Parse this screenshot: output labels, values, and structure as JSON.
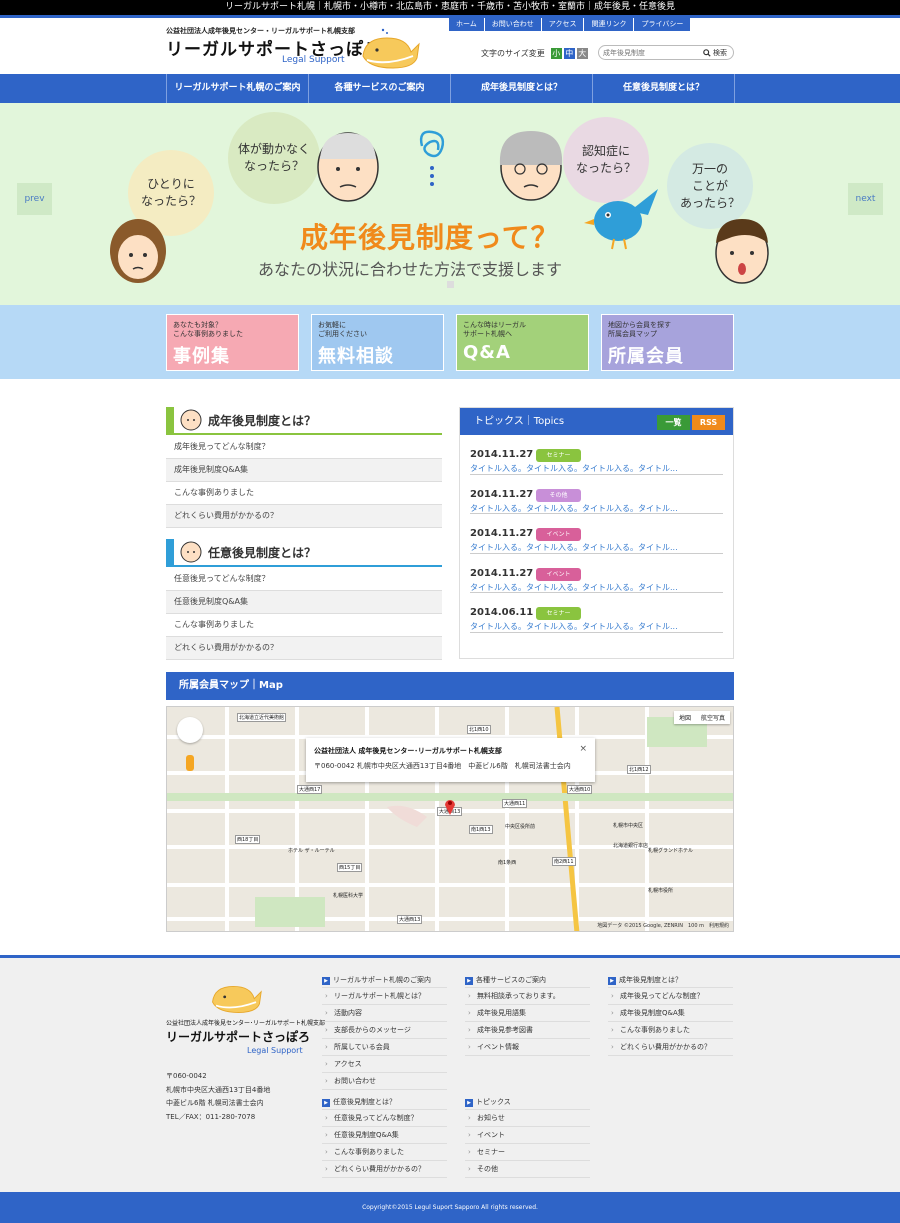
{
  "topbar": {
    "text": "リーガルサポート札幌｜札幌市・小樽市・北広島市・恵庭市・千歳市・苫小牧市・室蘭市｜成年後見・任意後見"
  },
  "header": {
    "org": "公益社団法人成年後見センター・リーガルサポート札幌支部",
    "brand": "リーガルサポートさっぽろ",
    "brand_sub": "Legal Support",
    "util_nav": [
      "ホーム",
      "お問い合わせ",
      "アクセス",
      "関連リンク",
      "プライバシー"
    ],
    "fontsize_label": "文字のサイズ変更",
    "fontsize_options": [
      "小",
      "中",
      "大"
    ],
    "search_placeholder": "成年後見制度",
    "search_button": "検索"
  },
  "gnav": [
    "リーガルサポート札幌のご案内",
    "各種サービスのご案内",
    "成年後見制度とは？",
    "任意後見制度とは？"
  ],
  "hero": {
    "bubbles": [
      "ひとりに\nなったら？",
      "体が動かなく\nなったら？",
      "認知症に\nなったら？",
      "万一の\nことが\nあったら？"
    ],
    "title": "成年後見制度って？",
    "subtitle": "あなたの状況に合わせた方法で支援します",
    "prev": "prev",
    "next": "next"
  },
  "banners": [
    {
      "top": "あなたも対象？\nこんな事例ありました",
      "big": "事例集",
      "color": "#f6a9b3"
    },
    {
      "top": "お気軽に\nご利用ください",
      "big": "無料相談",
      "color": "#9fc8f0"
    },
    {
      "top": "こんな時はリーガル\nサポート札幌へ",
      "big": "Q&A",
      "color": "#a3d17a"
    },
    {
      "top": "地図から会員を探す\n所属会員マップ",
      "big": "所属会員",
      "color": "#a7a3dc"
    }
  ],
  "seinen": {
    "title": "成年後見制度とは？",
    "items": [
      "成年後見ってどんな制度？",
      "成年後見制度Q&A集",
      "こんな事例ありました",
      "どれくらい費用がかかるの？"
    ]
  },
  "nini": {
    "title": "任意後見制度とは？",
    "items": [
      "任意後見ってどんな制度？",
      "任意後見制度Q&A集",
      "こんな事例ありました",
      "どれくらい費用がかかるの？"
    ]
  },
  "topics": {
    "title": "トピックス｜Topics",
    "ichiran": "一覧",
    "rss": "RSS",
    "items": [
      {
        "date": "2014.11.27",
        "badge": "セミナー",
        "badge_color": "#8ac43f",
        "title": "タイトル入る。タイトル入る。タイトル入る。タイトル..."
      },
      {
        "date": "2014.11.27",
        "badge": "その他",
        "badge_color": "#c88fd8",
        "title": "タイトル入る。タイトル入る。タイトル入る。タイトル..."
      },
      {
        "date": "2014.11.27",
        "badge": "イベント",
        "badge_color": "#d8609a",
        "title": "タイトル入る。タイトル入る。タイトル入る。タイトル..."
      },
      {
        "date": "2014.11.27",
        "badge": "イベント",
        "badge_color": "#d8609a",
        "title": "タイトル入る。タイトル入る。タイトル入る。タイトル..."
      },
      {
        "date": "2014.06.11",
        "badge": "セミナー",
        "badge_color": "#8ac43f",
        "title": "タイトル入る。タイトル入る。タイトル入る。タイトル..."
      }
    ]
  },
  "map": {
    "title": "所属会員マップ｜Map",
    "popup_title": "公益社団法人 成年後見センター･リーガルサポート札幌支部",
    "popup_address": "〒060-0042 札幌市中央区大通西13丁目4番地　中菱ビル6階　札幌司法書士会内",
    "type_map": "地図",
    "type_satellite": "航空写真",
    "copyright": "地図データ ©2015 Google, ZENRIN　100 m　利用規約",
    "labels": [
      "北海道立近代美術館",
      "大通西17",
      "大通西13",
      "大通西11",
      "大通西10",
      "南1西13",
      "南1条西",
      "中央区役所前",
      "西15丁目",
      "西18丁目",
      "札幌市中央区",
      "北1西10",
      "北1西12",
      "南2西11",
      "札幌医科大学",
      "ホテル ザ・ルーテル",
      "北海道銀行本店",
      "大通西13",
      "札幌市役所",
      "札幌グランドホテル"
    ]
  },
  "footer": {
    "org": "公益社団法人成年後見センター･リーガルサポート札幌支部",
    "brand": "リーガルサポートさっぽろ",
    "brand_sub": "Legal Support",
    "address": "〒060-0042\n札幌市中央区大通西13丁目4番地\n中菱ビル6階 札幌司法書士会内\nTEL／FAX：011-280-7078",
    "cols": [
      {
        "head": "リーガルサポート札幌のご案内",
        "items": [
          "リーガルサポート札幌とは？",
          "活動内容",
          "支部長からのメッセージ",
          "所属している会員",
          "アクセス",
          "お問い合わせ"
        ]
      },
      {
        "head": "各種サービスのご案内",
        "items": [
          "無料相談承っております。",
          "成年後見用語集",
          "成年後見参考図書",
          "イベント情報"
        ]
      },
      {
        "head": "成年後見制度とは？",
        "items": [
          "成年後見ってどんな制度？",
          "成年後見制度Q&A集",
          "こんな事例ありました",
          "どれくらい費用がかかるの？"
        ]
      },
      {
        "head": "任意後見制度とは？",
        "items": [
          "任意後見ってどんな制度？",
          "任意後見制度Q&A集",
          "こんな事例ありました",
          "どれくらい費用がかかるの？"
        ]
      },
      {
        "head": "トピックス",
        "items": [
          "お知らせ",
          "イベント",
          "セミナー",
          "その他"
        ]
      }
    ],
    "copyright": "Copyright©2015 Legul Suport Sapporo All rights reserved."
  }
}
